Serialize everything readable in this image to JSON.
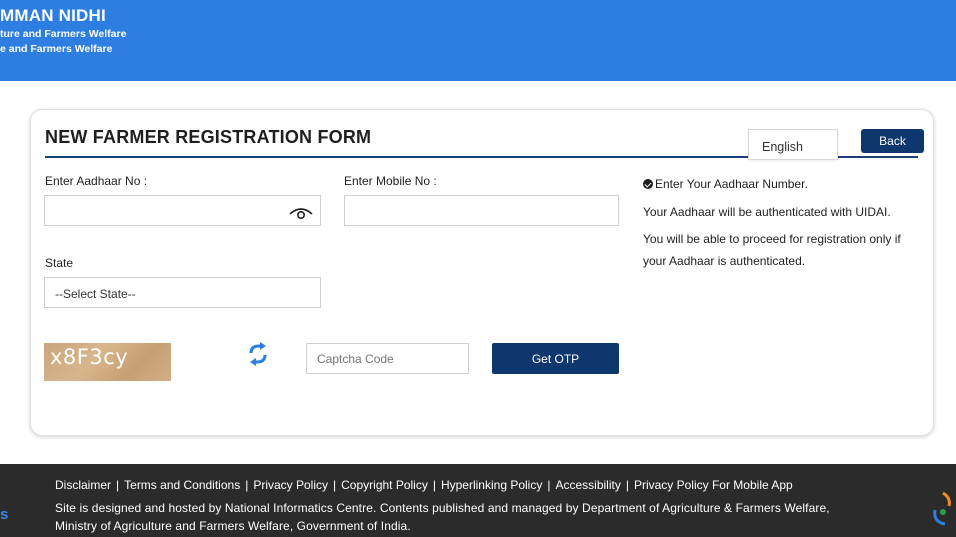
{
  "header": {
    "title_fragment": "MMAN NIDHI",
    "line2_fragment": "ture and Farmers Welfare",
    "line3_fragment": "e and Farmers Welfare"
  },
  "form": {
    "title": "NEW FARMER REGISTRATION FORM",
    "language": "English",
    "back_label": "Back",
    "aadhaar_label": "Enter Aadhaar No :",
    "aadhaar_value": "",
    "mobile_label": "Enter Mobile No :",
    "mobile_value": "",
    "state_label": "State",
    "state_selected": "--Select State--",
    "captcha_text": "x8F3cy",
    "captcha_placeholder": "Captcha Code",
    "otp_label": "Get OTP"
  },
  "info": {
    "line1": "Enter Your Aadhaar Number.",
    "line2": "Your Aadhaar will be authenticated with UIDAI.",
    "line3": "You will be able to proceed for registration only if",
    "line4": "your Aadhaar is authenticated."
  },
  "footer": {
    "links": [
      "Disclaimer",
      "Terms and Conditions",
      "Privacy Policy",
      "Copyright Policy",
      "Hyperlinking Policy",
      "Accessibility",
      "Privacy Policy For Mobile App"
    ],
    "separator": "|",
    "credit_line1": "Site is designed and hosted by National Informatics Centre. Contents published and managed by Department of Agriculture & Farmers Welfare,",
    "credit_line2": "Ministry of Agriculture and Farmers Welfare, Government of India.",
    "left_logo_fragment": "s"
  },
  "colors": {
    "header_bg": "#2d7ee0",
    "primary_button": "#0e3770",
    "footer_bg": "#2b2b2b"
  },
  "icons": {
    "aadhaar_toggle": "eye-icon",
    "captcha_refresh": "refresh-icon",
    "info_check": "check-circle-icon"
  }
}
